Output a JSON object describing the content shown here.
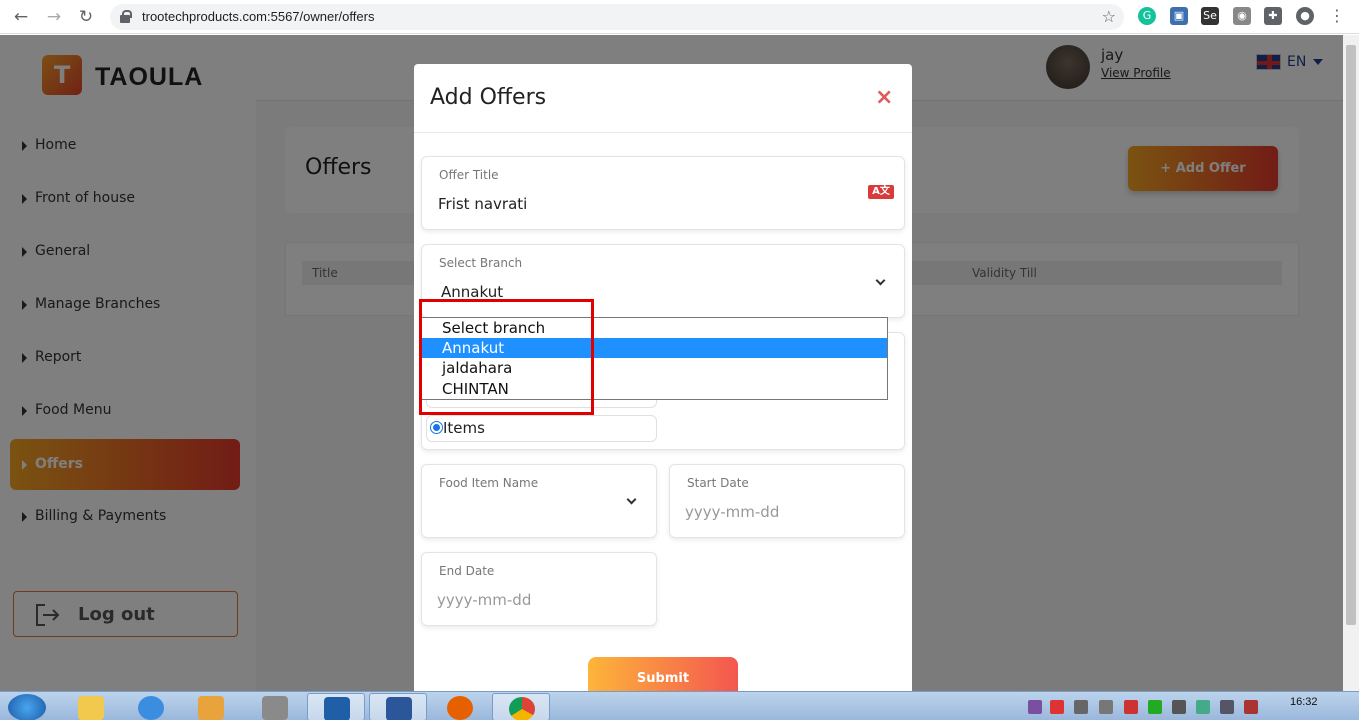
{
  "browser": {
    "url": "trootechproducts.com:5567/owner/offers"
  },
  "brand": {
    "name": "TAOULA",
    "logo_glyph": "T"
  },
  "sidebar": {
    "items": [
      {
        "label": "Home"
      },
      {
        "label": "Front of house"
      },
      {
        "label": "General"
      },
      {
        "label": "Manage Branches"
      },
      {
        "label": "Report"
      },
      {
        "label": "Food Menu"
      },
      {
        "label": "Offers"
      },
      {
        "label": "Billing & Payments"
      }
    ],
    "active_index": 6,
    "logout_label": "Log out"
  },
  "header": {
    "user_name": "jay",
    "view_profile": "View Profile",
    "language": "EN"
  },
  "main": {
    "title": "Offers",
    "add_button": "+ Add Offer",
    "table_columns": [
      "Title",
      "Validity Till"
    ]
  },
  "modal": {
    "title": "Add Offers",
    "close": "×",
    "offer_title": {
      "label": "Offer Title",
      "value": "Frist navrati"
    },
    "branch": {
      "label": "Select Branch",
      "value": "Annakut"
    },
    "branch_options": [
      "Select branch",
      "Annakut",
      "jaldahara",
      "CHINTAN"
    ],
    "branch_selected_index": 1,
    "radio_items_label": "Items",
    "food_item": {
      "label": "Food Item Name"
    },
    "start_date": {
      "label": "Start Date",
      "placeholder": "yyyy-mm-dd"
    },
    "end_date": {
      "label": "End Date",
      "placeholder": "yyyy-mm-dd"
    },
    "submit": "Submit"
  },
  "taskbar": {
    "time": "16:32"
  },
  "colors": {
    "accent_start": "#f5a623",
    "accent_end": "#e4392b",
    "dropdown_selected": "#1e90ff",
    "highlight": "#e00000"
  }
}
